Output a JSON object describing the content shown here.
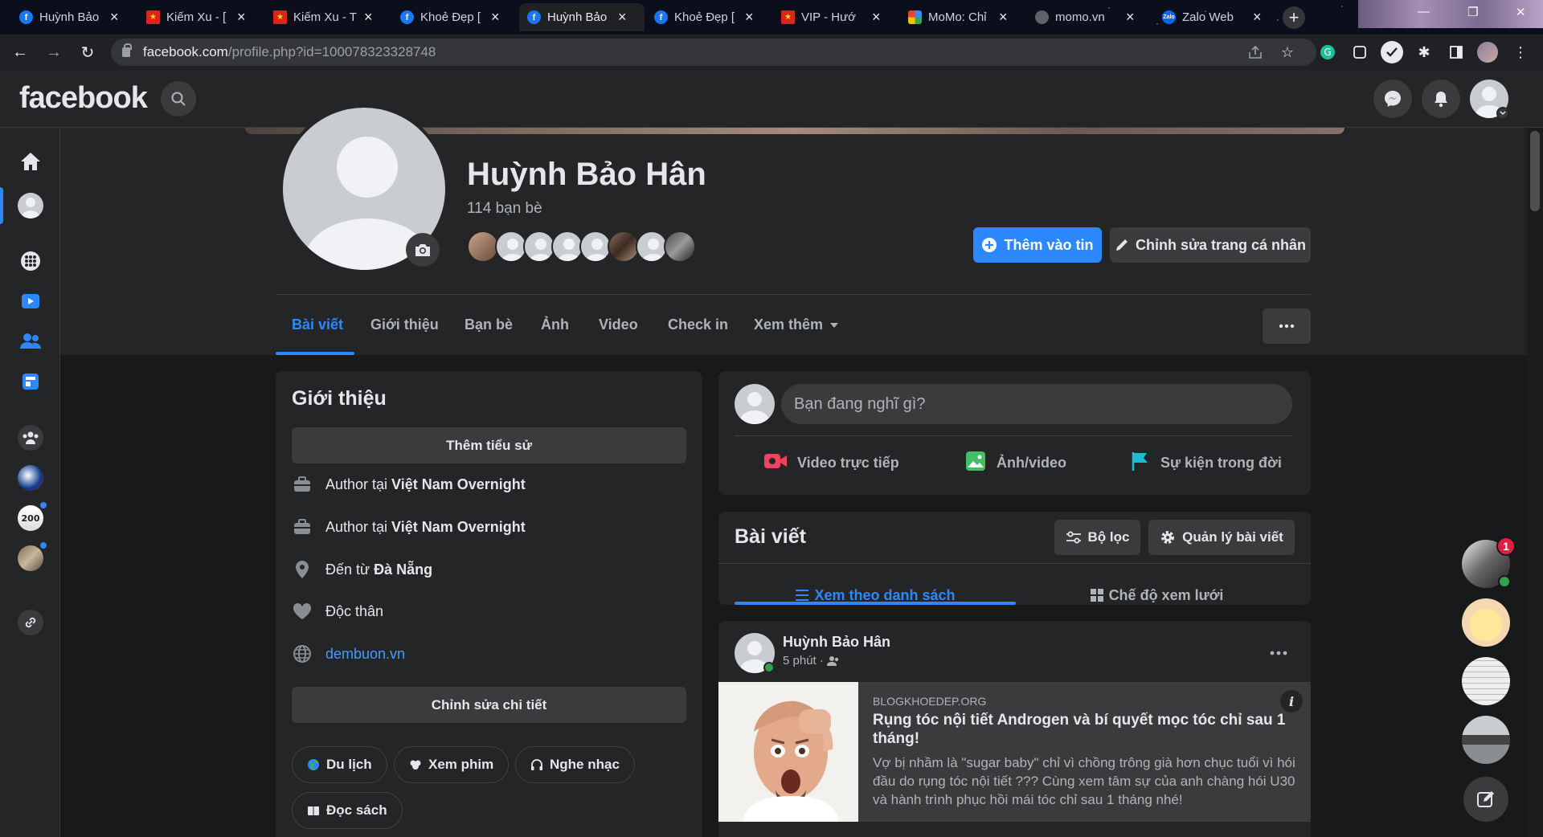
{
  "browser": {
    "tabs": [
      {
        "title": "Huỳnh Bảo",
        "favicon": "fb",
        "active": false
      },
      {
        "title": "Kiếm Xu - [",
        "favicon": "vn",
        "active": false
      },
      {
        "title": "Kiếm Xu - T",
        "favicon": "vn",
        "active": false
      },
      {
        "title": "Khoẻ Đẹp [",
        "favicon": "fb",
        "active": false
      },
      {
        "title": "Huỳnh Bảo",
        "favicon": "fb",
        "active": true
      },
      {
        "title": "Khoẻ Đẹp [",
        "favicon": "fb",
        "active": false
      },
      {
        "title": "VIP - Hướ",
        "favicon": "vn",
        "active": false
      },
      {
        "title": "MoMo: Chỉ",
        "favicon": "momo",
        "active": false
      },
      {
        "title": "momo.vn",
        "favicon": "gray",
        "active": false
      },
      {
        "title": "Zalo Web",
        "favicon": "zalo",
        "active": false
      }
    ],
    "url_host": "facebook.com",
    "url_path": "/profile.php?id=100078323328748"
  },
  "header": {
    "logo": "facebook"
  },
  "profile": {
    "name": "Huỳnh Bảo Hân",
    "friends_count": "114 bạn bè",
    "add_story_label": "Thêm vào tin",
    "edit_profile_label": "Chỉnh sửa trang cá nhân",
    "tabs": [
      "Bài viết",
      "Giới thiệu",
      "Bạn bè",
      "Ảnh",
      "Video",
      "Check in",
      "Xem thêm"
    ]
  },
  "intro": {
    "title": "Giới thiệu",
    "add_bio_label": "Thêm tiểu sử",
    "rows": [
      {
        "icon": "briefcase-icon",
        "prefix": "Author tại",
        "bold": "Việt Nam Overnight"
      },
      {
        "icon": "briefcase-icon",
        "prefix": "Author tại",
        "bold": "Việt Nam Overnight"
      },
      {
        "icon": "location-pin-icon",
        "prefix": "Đến từ",
        "bold": "Đà Nẵng"
      },
      {
        "icon": "heart-icon",
        "prefix": "Độc thân",
        "bold": ""
      }
    ],
    "website": "dembuon.vn",
    "edit_details_label": "Chỉnh sửa chi tiết",
    "hobbies": [
      "Du lịch",
      "Xem phim",
      "Nghe nhạc",
      "Đọc sách"
    ]
  },
  "composer": {
    "placeholder": "Bạn đang nghĩ gì?",
    "live_label": "Video trực tiếp",
    "photo_label": "Ảnh/video",
    "event_label": "Sự kiện trong đời"
  },
  "posts_panel": {
    "title": "Bài viết",
    "filter_label": "Bộ lọc",
    "manage_label": "Quản lý bài viết",
    "list_view_label": "Xem theo danh sách",
    "grid_view_label": "Chế độ xem lưới"
  },
  "post": {
    "author": "Huỳnh Bảo Hân",
    "time": "5 phút",
    "link_domain": "BLOGKHOEDEP.ORG",
    "link_title": "Rụng tóc nội tiết Androgen và bí quyết mọc tóc chỉ sau 1 tháng!",
    "link_desc": "Vợ bị nhầm là \"sugar baby\" chỉ vì chồng trông già hơn chục tuổi vì hói đầu do rụng tóc nội tiết ??? Cùng xem tâm sự của anh chàng hói U30 và hành trình phục hồi mái tóc chỉ sau 1 tháng nhé!"
  },
  "contacts": {
    "unread_badge": "1"
  },
  "colors": {
    "accent": "#2d88ff",
    "surface": "#242526",
    "background": "#18191a"
  }
}
